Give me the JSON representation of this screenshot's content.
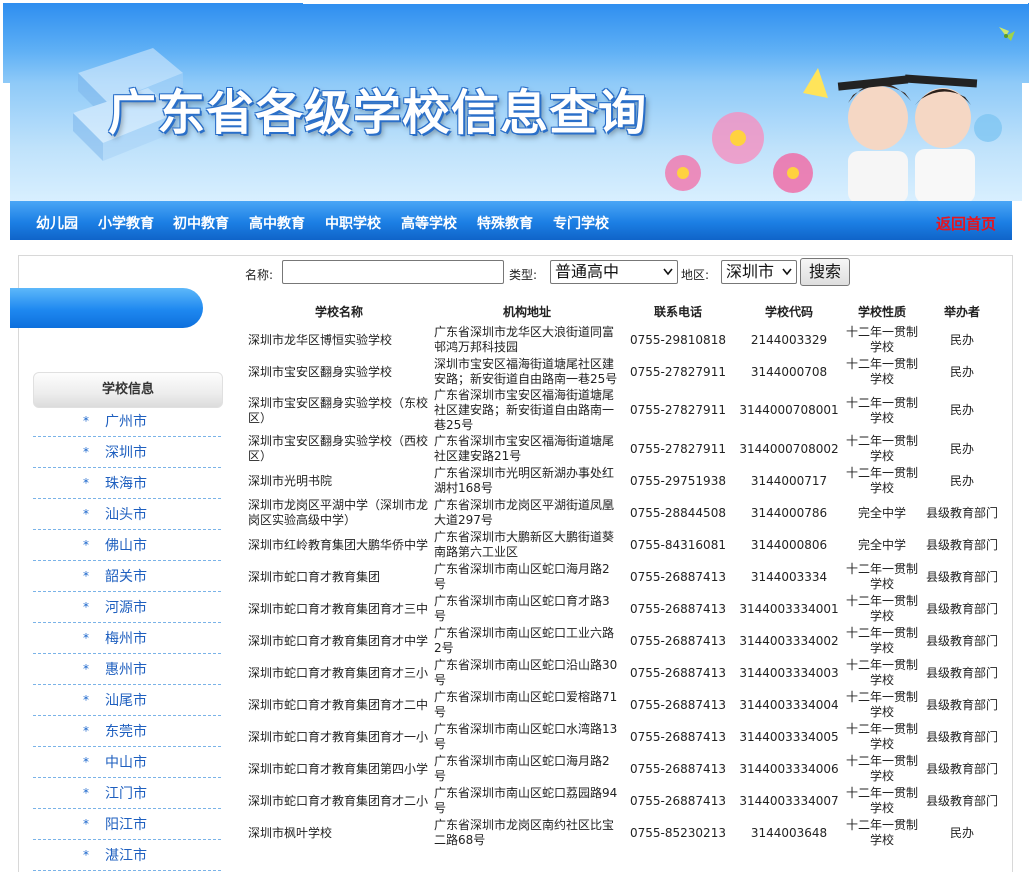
{
  "banner": {
    "title": "广东省各级学校信息查询"
  },
  "nav": {
    "items": [
      "幼儿园",
      "小学教育",
      "初中教育",
      "高中教育",
      "中职学校",
      "高等学校",
      "特殊教育",
      "专门学校"
    ],
    "home": "返回首页"
  },
  "sidebar": {
    "header": "学校信息",
    "bullet": "*",
    "cities": [
      "广州市",
      "深圳市",
      "珠海市",
      "汕头市",
      "佛山市",
      "韶关市",
      "河源市",
      "梅州市",
      "惠州市",
      "汕尾市",
      "东莞市",
      "中山市",
      "江门市",
      "阳江市",
      "湛江市"
    ]
  },
  "search": {
    "name_label": "名称:",
    "name_value": "",
    "type_label": "类型:",
    "type_value": "普通高中",
    "region_label": "地区:",
    "region_value": "深圳市",
    "button": "搜索"
  },
  "table": {
    "headers": [
      "学校名称",
      "机构地址",
      "联系电话",
      "学校代码",
      "学校性质",
      "举办者"
    ],
    "rows": [
      [
        "深圳市龙华区博恒实验学校",
        "广东省深圳市龙华区大浪街道同富邨鸿万邦科技园",
        "0755-29810818",
        "2144003329",
        "十二年一贯制学校",
        "民办"
      ],
      [
        "深圳市宝安区翻身实验学校",
        "深圳市宝安区福海街道塘尾社区建安路；新安街道自由路南一巷25号",
        "0755-27827911",
        "3144000708",
        "十二年一贯制学校",
        "民办"
      ],
      [
        "深圳市宝安区翻身实验学校（东校区）",
        "广东省深圳市宝安区福海街道塘尾社区建安路；新安街道自由路南一巷25号",
        "0755-27827911",
        "3144000708001",
        "十二年一贯制学校",
        "民办"
      ],
      [
        "深圳市宝安区翻身实验学校（西校区）",
        "广东省深圳市宝安区福海街道塘尾社区建安路21号",
        "0755-27827911",
        "3144000708002",
        "十二年一贯制学校",
        "民办"
      ],
      [
        "深圳市光明书院",
        "广东省深圳市光明区新湖办事处红湖村168号",
        "0755-29751938",
        "3144000717",
        "十二年一贯制学校",
        "民办"
      ],
      [
        "深圳市龙岗区平湖中学（深圳市龙岗区实验高级中学）",
        "广东省深圳市龙岗区平湖街道凤凰大道297号",
        "0755-28844508",
        "3144000786",
        "完全中学",
        "县级教育部门"
      ],
      [
        "深圳市红岭教育集团大鹏华侨中学",
        "广东省深圳市大鹏新区大鹏街道葵南路第六工业区",
        "0755-84316081",
        "3144000806",
        "完全中学",
        "县级教育部门"
      ],
      [
        "深圳市蛇口育才教育集团",
        "广东省深圳市南山区蛇口海月路2号",
        "0755-26887413",
        "3144003334",
        "十二年一贯制学校",
        "县级教育部门"
      ],
      [
        "深圳市蛇口育才教育集团育才三中",
        "广东省深圳市南山区蛇口育才路3号",
        "0755-26887413",
        "3144003334001",
        "十二年一贯制学校",
        "县级教育部门"
      ],
      [
        "深圳市蛇口育才教育集团育才中学",
        "广东省深圳市南山区蛇口工业六路2号",
        "0755-26887413",
        "3144003334002",
        "十二年一贯制学校",
        "县级教育部门"
      ],
      [
        "深圳市蛇口育才教育集团育才三小",
        "广东省深圳市南山区蛇口沿山路30号",
        "0755-26887413",
        "3144003334003",
        "十二年一贯制学校",
        "县级教育部门"
      ],
      [
        "深圳市蛇口育才教育集团育才二中",
        "广东省深圳市南山区蛇口爱榕路71号",
        "0755-26887413",
        "3144003334004",
        "十二年一贯制学校",
        "县级教育部门"
      ],
      [
        "深圳市蛇口育才教育集团育才一小",
        "广东省深圳市南山区蛇口水湾路13号",
        "0755-26887413",
        "3144003334005",
        "十二年一贯制学校",
        "县级教育部门"
      ],
      [
        "深圳市蛇口育才教育集团第四小学",
        "广东省深圳市南山区蛇口海月路2号",
        "0755-26887413",
        "3144003334006",
        "十二年一贯制学校",
        "县级教育部门"
      ],
      [
        "深圳市蛇口育才教育集团育才二小",
        "广东省深圳市南山区蛇口荔园路94号",
        "0755-26887413",
        "3144003334007",
        "十二年一贯制学校",
        "县级教育部门"
      ],
      [
        "深圳市枫叶学校",
        "广东省深圳市龙岗区南约社区比宝二路68号",
        "0755-85230213",
        "3144003648",
        "十二年一贯制学校",
        "民办"
      ]
    ]
  },
  "colors": {
    "nav_blue": "#1c7fe4",
    "home_red": "#e8141c",
    "link_blue": "#1e5fbf"
  },
  "icons": {
    "banner_left": "books-icon",
    "banner_right": "students-flowers-icon",
    "corner": "pinwheel-icon"
  }
}
